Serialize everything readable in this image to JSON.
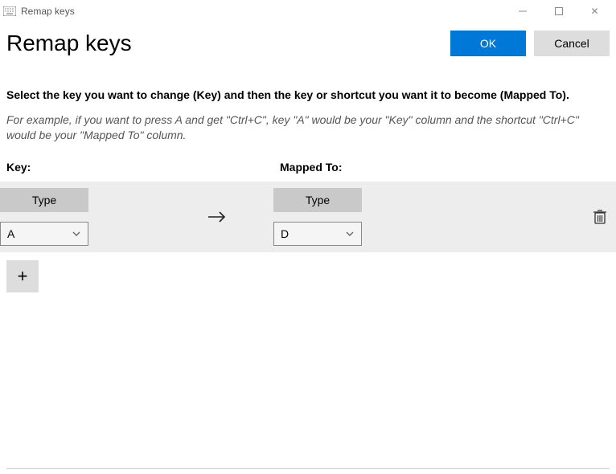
{
  "window": {
    "title": "Remap keys"
  },
  "header": {
    "page_title": "Remap keys",
    "ok_label": "OK",
    "cancel_label": "Cancel"
  },
  "content": {
    "instruction": "Select the key you want to change (Key) and then the key or shortcut you want it to become (Mapped To).",
    "example": "For example, if you want to press A and get \"Ctrl+C\", key \"A\" would be your \"Key\" column and the shortcut \"Ctrl+C\" would be your \"Mapped To\" column.",
    "key_header": "Key:",
    "mapped_header": "Mapped To:"
  },
  "row": {
    "key_type_label": "Type",
    "key_value": "A",
    "mapped_type_label": "Type",
    "mapped_value": "D"
  },
  "icons": {
    "add": "+",
    "close": "✕"
  }
}
